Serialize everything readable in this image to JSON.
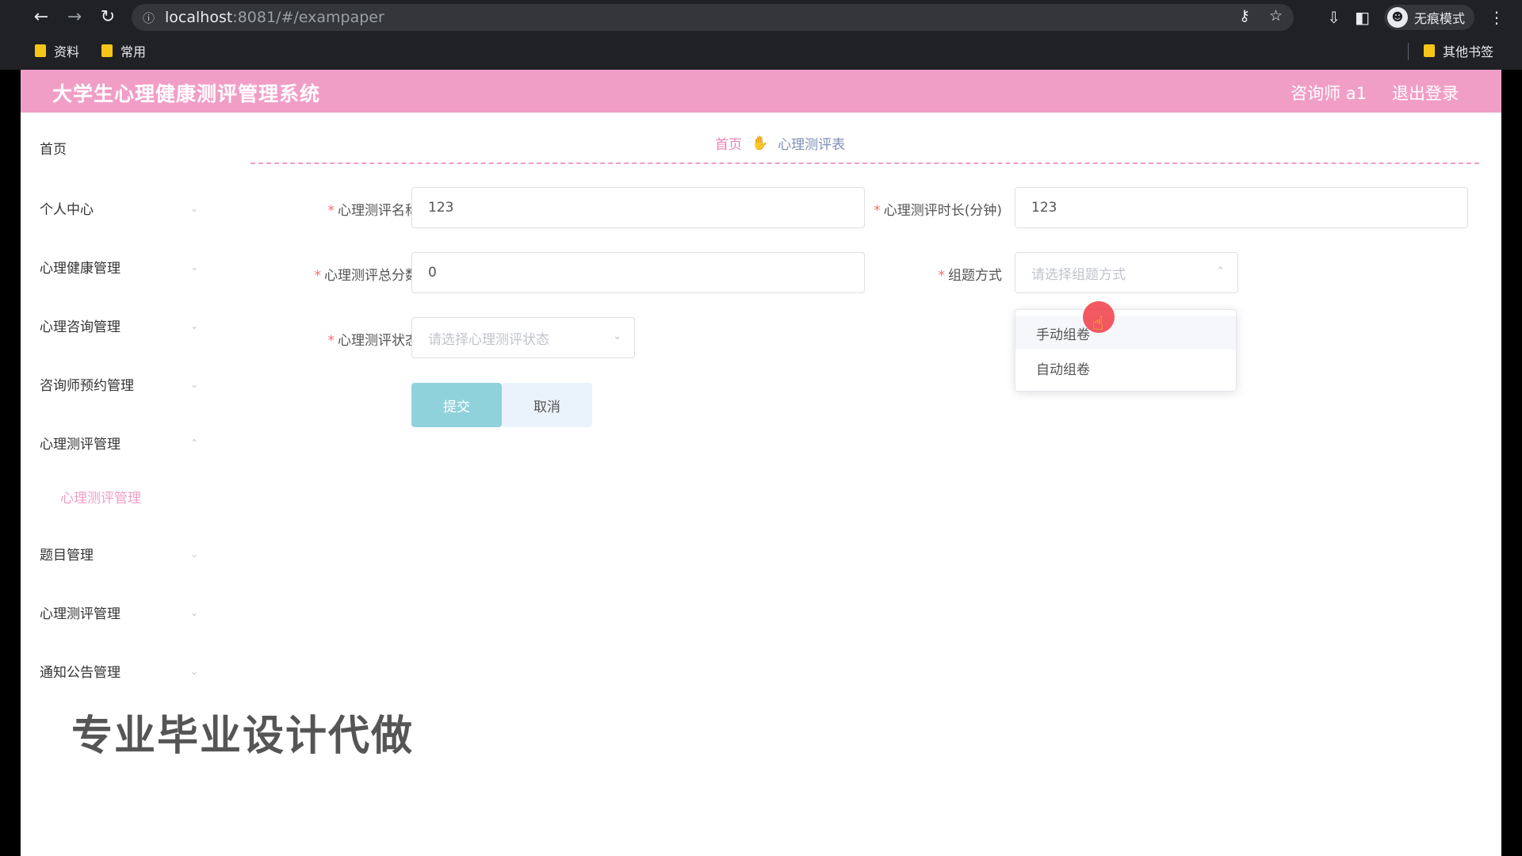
{
  "browser": {
    "url_host": "localhost",
    "url_path": ":8081/#/exampaper",
    "incognito_label": "无痕模式",
    "bookmarks": [
      {
        "label": "资料"
      },
      {
        "label": "常用"
      }
    ],
    "other_bookmarks": "其他书签"
  },
  "header": {
    "title": "大学生心理健康测评管理系统",
    "user": "咨询师 a1",
    "logout": "退出登录"
  },
  "sidebar": {
    "items": [
      {
        "label": "首页"
      },
      {
        "label": "个人中心"
      },
      {
        "label": "心理健康管理"
      },
      {
        "label": "心理咨询管理"
      },
      {
        "label": "咨询师预约管理"
      },
      {
        "label": "心理测评管理"
      },
      {
        "label": "题目管理"
      },
      {
        "label": "心理测评管理"
      },
      {
        "label": "通知公告管理"
      }
    ],
    "active_sub": "心理测评管理"
  },
  "breadcrumb": {
    "home": "首页",
    "current": "心理测评表"
  },
  "form": {
    "name_label": "心理测评名称",
    "name_value": "123",
    "duration_label": "心理测评时长(分钟)",
    "duration_value": "123",
    "total_label": "心理测评总分数",
    "total_value": "0",
    "mode_label": "组题方式",
    "mode_placeholder": "请选择组题方式",
    "status_label": "心理测评状态",
    "status_placeholder": "请选择心理测评状态",
    "submit": "提交",
    "cancel": "取消"
  },
  "dropdown": {
    "options": [
      "手动组卷",
      "自动组卷"
    ]
  },
  "watermark": "专业毕业设计代做",
  "colors": {
    "header": "#f19ec7",
    "submit": "#90d2dc",
    "required": "#f56c6c"
  }
}
